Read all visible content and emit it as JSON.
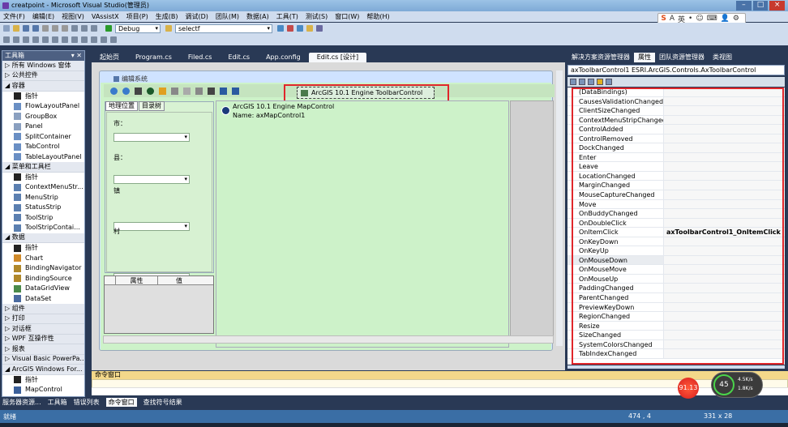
{
  "window": {
    "title": "creatpoint - Microsoft Visual Studio(管理员)",
    "buttons": [
      "–",
      "□",
      "×"
    ]
  },
  "menu": [
    "文件(F)",
    "编辑(E)",
    "视图(V)",
    "VAssistX",
    "项目(P)",
    "生成(B)",
    "调试(D)",
    "团队(M)",
    "数据(A)",
    "工具(T)",
    "测试(S)",
    "窗口(W)",
    "帮助(H)"
  ],
  "ime": {
    "s": "S",
    "a": "A",
    "ying": "英",
    "items": [
      "•",
      "☺",
      "⌨",
      "👤",
      "⚙"
    ]
  },
  "toolbar": {
    "config": "Debug",
    "find": "selectf"
  },
  "toolbox": {
    "title": "工具箱",
    "pin": "▾ ✕",
    "items": [
      {
        "type": "cat",
        "label": "▷ 所有 Windows 窗体"
      },
      {
        "type": "cat",
        "label": "▷ 公共控件"
      },
      {
        "type": "cat",
        "label": "◢ 容器"
      },
      {
        "type": "sub",
        "label": "指针",
        "icon": "#222"
      },
      {
        "type": "sub",
        "label": "FlowLayoutPanel",
        "icon": "#6a8fc4"
      },
      {
        "type": "sub",
        "label": "GroupBox",
        "icon": "#8aa0c0"
      },
      {
        "type": "sub",
        "label": "Panel",
        "icon": "#8aa0c0"
      },
      {
        "type": "sub",
        "label": "SplitContainer",
        "icon": "#6a8fc4"
      },
      {
        "type": "sub",
        "label": "TabControl",
        "icon": "#6a8fc4"
      },
      {
        "type": "sub",
        "label": "TableLayoutPanel",
        "icon": "#6a8fc4"
      },
      {
        "type": "cat",
        "label": "◢ 菜单和工具栏"
      },
      {
        "type": "sub",
        "label": "指针",
        "icon": "#222"
      },
      {
        "type": "sub",
        "label": "ContextMenuStr...",
        "icon": "#5b7fb0"
      },
      {
        "type": "sub",
        "label": "MenuStrip",
        "icon": "#5b7fb0"
      },
      {
        "type": "sub",
        "label": "StatusStrip",
        "icon": "#5b7fb0"
      },
      {
        "type": "sub",
        "label": "ToolStrip",
        "icon": "#5b7fb0"
      },
      {
        "type": "sub",
        "label": "ToolStripContai...",
        "icon": "#5b7fb0"
      },
      {
        "type": "cat",
        "label": "◢ 数据"
      },
      {
        "type": "sub",
        "label": "指针",
        "icon": "#222"
      },
      {
        "type": "sub",
        "label": "Chart",
        "icon": "#d08a2a"
      },
      {
        "type": "sub",
        "label": "BindingNavigator",
        "icon": "#b0882a"
      },
      {
        "type": "sub",
        "label": "BindingSource",
        "icon": "#b0882a"
      },
      {
        "type": "sub",
        "label": "DataGridView",
        "icon": "#4a8a4a"
      },
      {
        "type": "sub",
        "label": "DataSet",
        "icon": "#4a6aa0"
      },
      {
        "type": "cat",
        "label": "▷ 组件"
      },
      {
        "type": "cat",
        "label": "▷ 打印"
      },
      {
        "type": "cat",
        "label": "▷ 对话框"
      },
      {
        "type": "cat",
        "label": "▷ WPF 互操作性"
      },
      {
        "type": "cat",
        "label": "▷ 报表"
      },
      {
        "type": "cat",
        "label": "▷ Visual Basic PowerPa..."
      },
      {
        "type": "cat",
        "label": "◢ ArcGIS Windows For..."
      },
      {
        "type": "sub",
        "label": "指针",
        "icon": "#222"
      },
      {
        "type": "sub",
        "label": "MapControl",
        "icon": "#3a5f9a"
      }
    ]
  },
  "doctabs": [
    "起始页",
    "Program.cs",
    "Filed.cs",
    "Edit.cs",
    "App.config",
    "Edit.cs [设计]"
  ],
  "designer": {
    "form_title": "编辑系统",
    "toolbar_control": "ArcGIS 10.1 Engine ToolbarControl",
    "tabs": [
      "地理位置",
      "目录树"
    ],
    "labels": [
      "市：",
      "县：",
      "镇",
      "村"
    ],
    "attr_headers": [
      "属性",
      "值"
    ],
    "map_title": "ArcGIS 10.1 Engine MapControl",
    "map_name": "Name: axMapControl1"
  },
  "props": {
    "tabs": [
      "解决方案资源管理器",
      "属性",
      "团队资源管理器",
      "类视图"
    ],
    "object": "axToolbarControl1  ESRI.ArcGIS.Controls.AxToolbarControl",
    "rows": [
      [
        "(DataBindings)",
        ""
      ],
      [
        "CausesValidationChanged",
        ""
      ],
      [
        "ClientSizeChanged",
        ""
      ],
      [
        "ContextMenuStripChanged",
        ""
      ],
      [
        "ControlAdded",
        ""
      ],
      [
        "ControlRemoved",
        ""
      ],
      [
        "DockChanged",
        ""
      ],
      [
        "Enter",
        ""
      ],
      [
        "Leave",
        ""
      ],
      [
        "LocationChanged",
        ""
      ],
      [
        "MarginChanged",
        ""
      ],
      [
        "MouseCaptureChanged",
        ""
      ],
      [
        "Move",
        ""
      ],
      [
        "OnBuddyChanged",
        ""
      ],
      [
        "OnDoubleClick",
        ""
      ],
      [
        "OnItemClick",
        "axToolbarControl1_OnItemClick"
      ],
      [
        "OnKeyDown",
        ""
      ],
      [
        "OnKeyUp",
        ""
      ],
      [
        "OnMouseDown",
        ""
      ],
      [
        "OnMouseMove",
        ""
      ],
      [
        "OnMouseUp",
        ""
      ],
      [
        "PaddingChanged",
        ""
      ],
      [
        "ParentChanged",
        ""
      ],
      [
        "PreviewKeyDown",
        ""
      ],
      [
        "RegionChanged",
        ""
      ],
      [
        "Resize",
        ""
      ],
      [
        "SizeChanged",
        ""
      ],
      [
        "SystemColorsChanged",
        ""
      ],
      [
        "TabIndexChanged",
        ""
      ]
    ]
  },
  "command": {
    "title": "命令窗口"
  },
  "bottomtabs": [
    "服务器资源...",
    "工具箱",
    "错误列表",
    "命令窗口",
    "查找符号结果"
  ],
  "status": {
    "left": "就绪",
    "pos": "474 , 4",
    "size": "331 x 28"
  },
  "overlay": {
    "cpu": "91.13",
    "pct": "45",
    "up": "4.5K/s",
    "down": "1.8K/s"
  }
}
